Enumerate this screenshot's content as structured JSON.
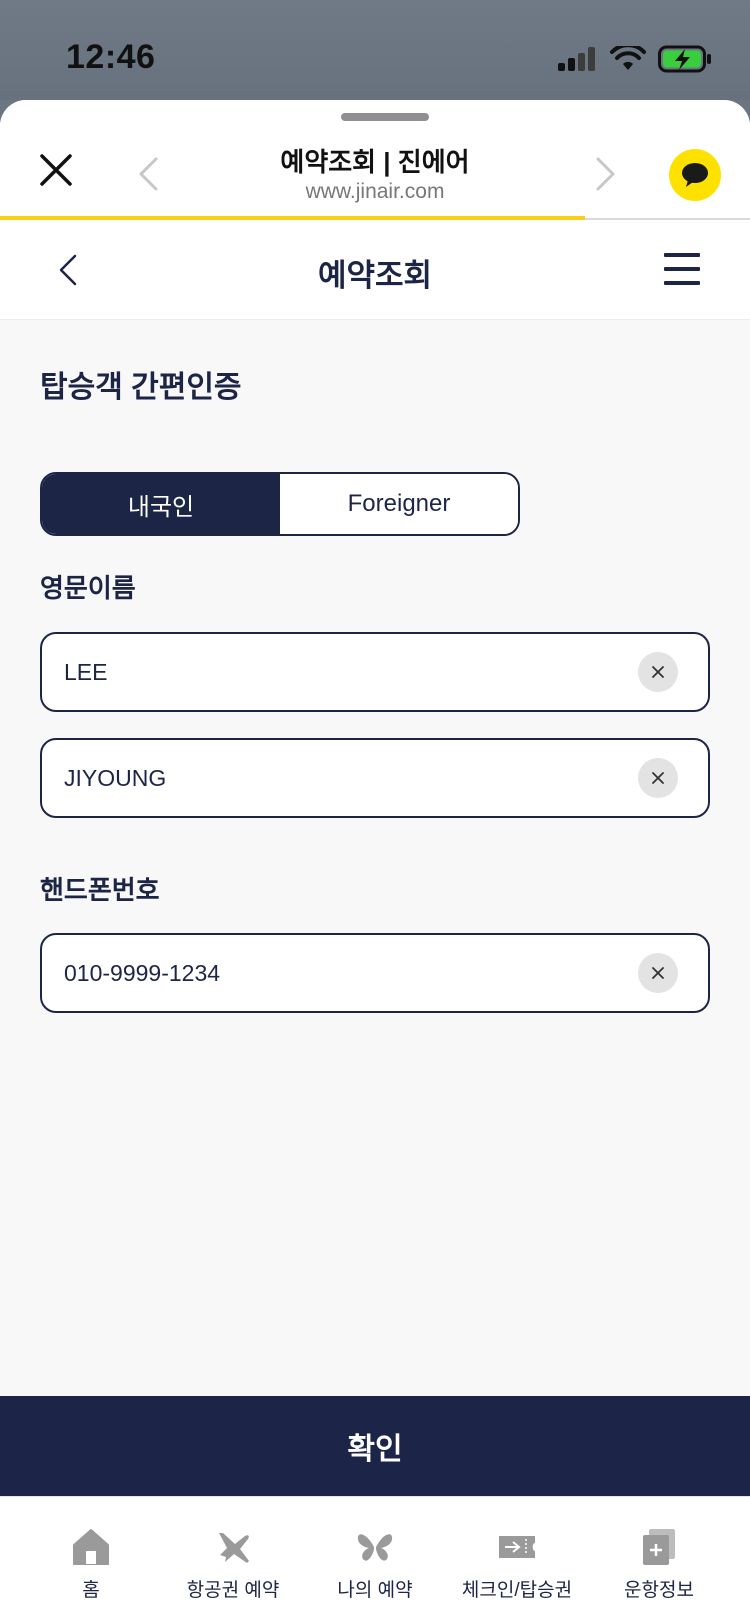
{
  "status_bar": {
    "time": "12:46"
  },
  "browser": {
    "title": "예약조회 | 진에어",
    "url": "www.jinair.com",
    "load_progress": 0.78
  },
  "header": {
    "title": "예약조회"
  },
  "auth": {
    "section_title": "탑승객 간편인증",
    "segments": [
      "내국인",
      "Foreigner"
    ],
    "selected_segment": "내국인"
  },
  "name": {
    "label": "영문이름",
    "last_name_value": "LEE",
    "first_name_value": "JIYOUNG"
  },
  "phone": {
    "label": "핸드폰번호",
    "value": "010-9999-1234"
  },
  "confirm_label": "확인",
  "tabs": [
    {
      "label": "홈",
      "icon": "home-icon"
    },
    {
      "label": "항공권 예약",
      "icon": "airplane-icon"
    },
    {
      "label": "나의 예약",
      "icon": "butterfly-icon"
    },
    {
      "label": "체크인/탑승권",
      "icon": "ticket-icon"
    },
    {
      "label": "운항정보",
      "icon": "document-plus-icon"
    }
  ],
  "colors": {
    "navy": "#1d2547",
    "accent_yellow": "#f9cf1c",
    "kakao_yellow": "#ffe100",
    "background": "#f8f8f8"
  }
}
